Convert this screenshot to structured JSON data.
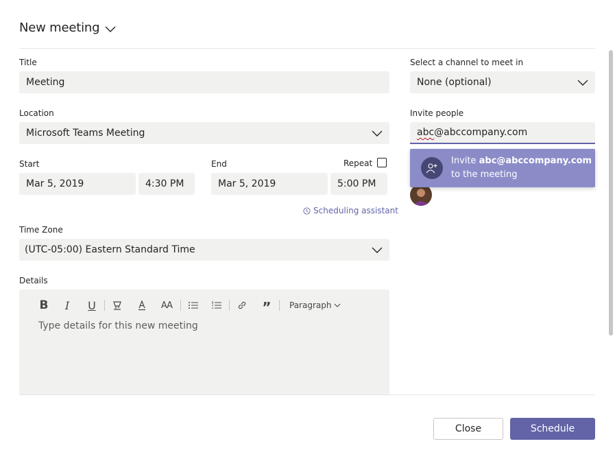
{
  "header": {
    "title": "New meeting",
    "chevron_icon": "chevron-down-icon"
  },
  "title_field": {
    "label": "Title",
    "value": "Meeting"
  },
  "location_field": {
    "label": "Location",
    "value": "Microsoft Teams Meeting"
  },
  "start": {
    "label": "Start",
    "date": "Mar 5, 2019",
    "time": "4:30 PM"
  },
  "end": {
    "label": "End",
    "date": "Mar 5, 2019",
    "time": "5:00 PM"
  },
  "repeat": {
    "label": "Repeat",
    "checked": false
  },
  "scheduling_assistant": {
    "label": "Scheduling assistant",
    "icon": "clock-icon"
  },
  "time_zone": {
    "label": "Time Zone",
    "value": "(UTC-05:00) Eastern Standard Time"
  },
  "details": {
    "label": "Details",
    "placeholder": "Type details for this new meeting",
    "toolbar": {
      "bold": "B",
      "italic": "I",
      "underline": "U",
      "font_size": "AA",
      "paragraph_label": "Paragraph"
    }
  },
  "channel": {
    "label": "Select a channel to meet in",
    "value": "None (optional)"
  },
  "invite": {
    "label": "Invite people",
    "value_prefix": "abc",
    "value_suffix": "@abccompany.com",
    "suggestion_prefix": "Invite ",
    "suggestion_email": "abc@abccompany.com",
    "suggestion_suffix": "to the meeting"
  },
  "actions": {
    "close_label": "Close",
    "schedule_label": "Schedule"
  },
  "colors": {
    "accent": "#6264a7",
    "suggestion_bg": "#8b8cc7",
    "field_bg": "#f1f1f0"
  }
}
